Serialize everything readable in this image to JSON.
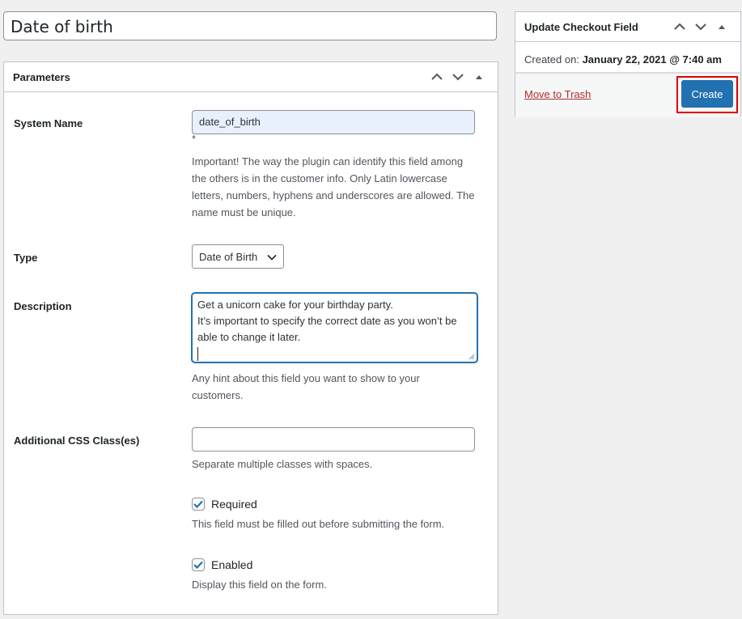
{
  "title_field": {
    "value": "Date of birth"
  },
  "parameters_box": {
    "title": "Parameters",
    "system_name": {
      "label": "System Name",
      "value": "date_of_birth",
      "asterisk": "*",
      "help": "Important! The way the plugin can identify this field among the others is in the customer info. Only Latin lowercase letters, numbers, hyphens and underscores are allowed. The name must be unique."
    },
    "type": {
      "label": "Type",
      "selected": "Date of Birth"
    },
    "description": {
      "label": "Description",
      "line1": "Get a unicorn cake for your birthday party.",
      "line2": "It’s important to specify the correct date as you won’t be able to change it later.",
      "help": "Any hint about this field you want to show to your customers."
    },
    "css_classes": {
      "label": "Additional CSS Class(es)",
      "value": "",
      "help": "Separate multiple classes with spaces."
    },
    "required": {
      "label": "Required",
      "checked": true,
      "help": "This field must be filled out before submitting the form."
    },
    "enabled": {
      "label": "Enabled",
      "checked": true,
      "help": "Display this field on the form."
    }
  },
  "update_box": {
    "title": "Update Checkout Field",
    "created_label": "Created on:",
    "created_value": "January 22, 2021 @ 7:40 am",
    "trash_label": "Move to Trash",
    "create_label": "Create",
    "highlight_color": "#e00000",
    "button_color": "#2271b1"
  }
}
